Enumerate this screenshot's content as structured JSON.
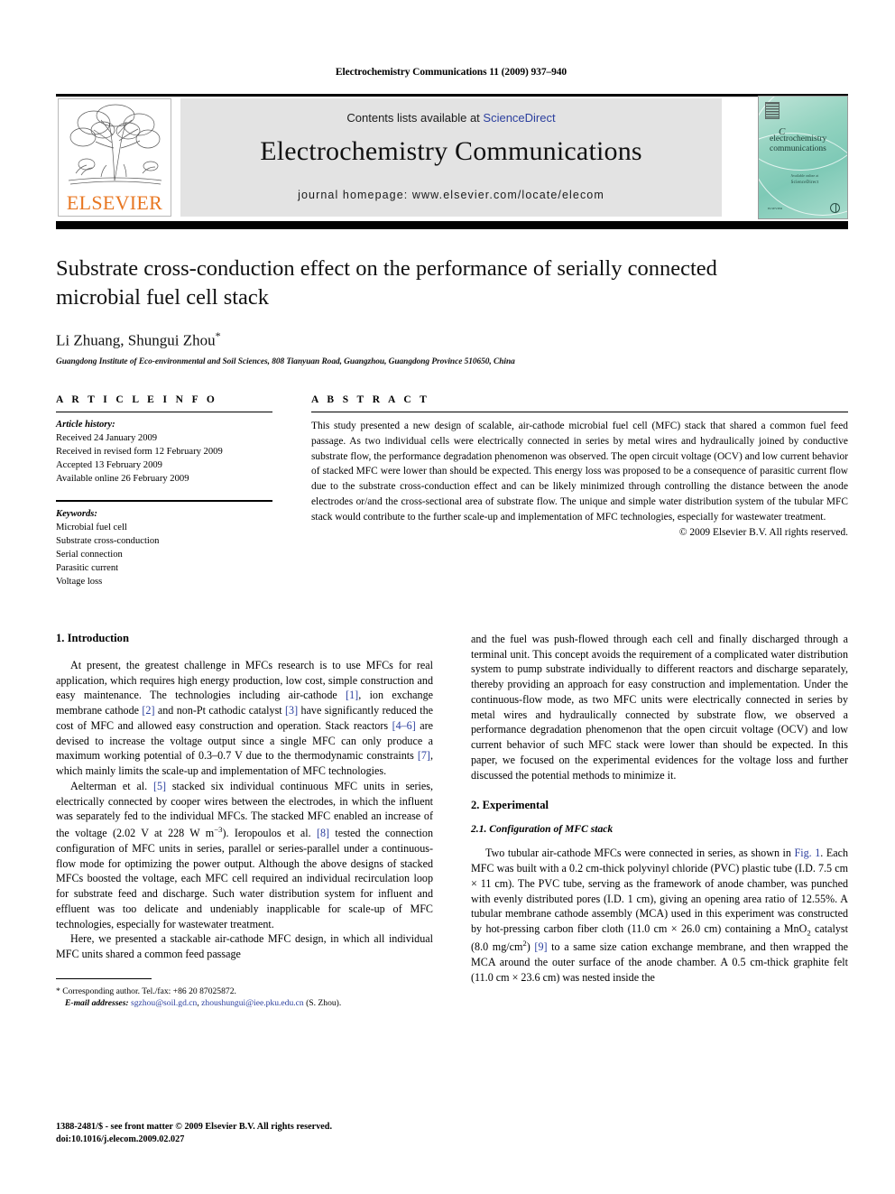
{
  "running_head": "Electrochemistry Communications 11 (2009) 937–940",
  "masthead": {
    "contents_prefix": "Contents lists available at ",
    "sciencedirect": "ScienceDirect",
    "journal_title": "Electrochemistry Communications",
    "homepage": "journal homepage: www.elsevier.com/locate/elecom",
    "publisher_wordmark": "ELSEVIER",
    "cover": {
      "title_line1": "electrochemistry",
      "title_line2": "communications",
      "initial": "C",
      "mid_caption": "Available online at",
      "mid_brand": "ScienceDirect",
      "bottom_left": "ELSEVIER",
      "bottom_right_alt": "globe-mark"
    },
    "accent_link_color": "#2b3f9e",
    "elsevier_orange": "#E87722",
    "masthead_bg": "#e3e3e3",
    "cover_teal": "#7ec9b6"
  },
  "title": "Substrate cross-conduction effect on the performance of serially connected microbial fuel cell stack",
  "authors": "Li Zhuang, Shungui Zhou",
  "corresponding_mark": "*",
  "affiliation": "Guangdong Institute of Eco-environmental and Soil Sciences, 808 Tianyuan Road, Guangzhou, Guangdong Province 510650, China",
  "article_info": {
    "heading": "A R T I C L E   I N F O",
    "history_label": "Article history:",
    "history": [
      "Received 24 January 2009",
      "Received in revised form 12 February 2009",
      "Accepted 13 February 2009",
      "Available online 26 February 2009"
    ],
    "keywords_label": "Keywords:",
    "keywords": [
      "Microbial fuel cell",
      "Substrate cross-conduction",
      "Serial connection",
      "Parasitic current",
      "Voltage loss"
    ]
  },
  "abstract": {
    "heading": "A B S T R A C T",
    "text": "This study presented a new design of scalable, air-cathode microbial fuel cell (MFC) stack that shared a common fuel feed passage. As two individual cells were electrically connected in series by metal wires and hydraulically joined by conductive substrate flow, the performance degradation phenomenon was observed. The open circuit voltage (OCV) and low current behavior of stacked MFC were lower than should be expected. This energy loss was proposed to be a consequence of parasitic current flow due to the substrate cross-conduction effect and can be likely minimized through controlling the distance between the anode electrodes or/and the cross-sectional area of substrate flow. The unique and simple water distribution system of the tubular MFC stack would contribute to the further scale-up and implementation of MFC technologies, especially for wastewater treatment.",
    "copyright": "© 2009 Elsevier B.V. All rights reserved."
  },
  "sections": {
    "introduction_heading": "1. Introduction",
    "intro_p1_a": "At present, the greatest challenge in MFCs research is to use MFCs for real application, which requires high energy production, low cost, simple construction and easy maintenance. The technologies including air-cathode ",
    "intro_p1_r1": "[1]",
    "intro_p1_b": ", ion exchange membrane cathode ",
    "intro_p1_r2": "[2]",
    "intro_p1_c": " and non-Pt cathodic catalyst ",
    "intro_p1_r3": "[3]",
    "intro_p1_d": " have significantly reduced the cost of MFC and allowed easy construction and operation. Stack reactors ",
    "intro_p1_r4": "[4–6]",
    "intro_p1_e": " are devised to increase the voltage output since a single MFC can only produce a maximum working potential of 0.3–0.7 V due to the thermodynamic constraints ",
    "intro_p1_r5": "[7]",
    "intro_p1_f": ", which mainly limits the scale-up and implementation of MFC technologies.",
    "intro_p2_a": "Aelterman et al. ",
    "intro_p2_r1": "[5]",
    "intro_p2_b": " stacked six individual continuous MFC units in series, electrically connected by cooper wires between the electrodes, in which the influent was separately fed to the individual MFCs. The stacked MFC enabled an increase of the voltage (2.02 V at 228 W m",
    "intro_p2_sup": "−3",
    "intro_p2_c": "). Ieropoulos et al. ",
    "intro_p2_r2": "[8]",
    "intro_p2_d": " tested the connection configuration of MFC units in series, parallel or series-parallel under a continuous-flow mode for optimizing the power output. Although the above designs of stacked MFCs boosted the voltage, each MFC cell required an individual recirculation loop for substrate feed and discharge. Such water distribution system for influent and effluent was too delicate and undeniably inapplicable for scale-up of MFC technologies, especially for wastewater treatment.",
    "intro_p3": "Here, we presented a stackable air-cathode MFC design, in which all individual MFC units shared a common feed passage",
    "right_p1": "and the fuel was push-flowed through each cell and finally discharged through a terminal unit. This concept avoids the requirement of a complicated water distribution system to pump substrate individually to different reactors and discharge separately, thereby providing an approach for easy construction and implementation. Under the continuous-flow mode, as two MFC units were electrically connected in series by metal wires and hydraulically connected by substrate flow, we observed a performance degradation phenomenon that the open circuit voltage (OCV) and low current behavior of such MFC stack were lower than should be expected. In this paper, we focused on the experimental evidences for the voltage loss and further discussed the potential methods to minimize it.",
    "experimental_heading": "2. Experimental",
    "subsection_heading": "2.1. Configuration of MFC stack",
    "exp_p1_a": "Two tubular air-cathode MFCs were connected in series, as shown in ",
    "exp_p1_fig": "Fig. 1",
    "exp_p1_b": ". Each MFC was built with a 0.2 cm-thick polyvinyl chloride (PVC) plastic tube (I.D. 7.5 cm × 11 cm). The PVC tube, serving as the framework of anode chamber, was punched with evenly distributed pores (I.D. 1 cm), giving an opening area ratio of 12.55%. A tubular membrane cathode assembly (MCA) used in this experiment was constructed by hot-pressing carbon fiber cloth (11.0 cm × 26.0 cm) containing a MnO",
    "exp_p1_sub": "2",
    "exp_p1_c": " catalyst (8.0 mg/cm",
    "exp_p1_sup": "2",
    "exp_p1_d": ") ",
    "exp_p1_r1": "[9]",
    "exp_p1_e": " to a same size cation exchange membrane, and then wrapped the MCA around the outer surface of the anode chamber. A 0.5 cm-thick graphite felt (11.0 cm × 23.6 cm) was nested inside the"
  },
  "footnote": {
    "star": "*",
    "corresponding": "Corresponding author. Tel./fax: +86 20 87025872.",
    "email_label": "E-mail addresses:",
    "email1": "sgzhou@soil.gd.cn",
    "email_sep": ", ",
    "email2": "zhoushungui@iee.pku.edu.cn",
    "email_suffix": " (S. Zhou)."
  },
  "footer": {
    "issn_line": "1388-2481/$ - see front matter © 2009 Elsevier B.V. All rights reserved.",
    "doi_line": "doi:10.1016/j.elecom.2009.02.027"
  }
}
